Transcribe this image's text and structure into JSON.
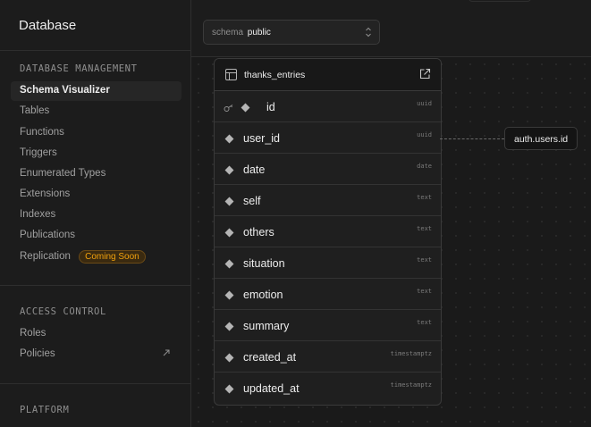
{
  "sidebar": {
    "title": "Database",
    "sections": {
      "management": {
        "title": "DATABASE MANAGEMENT",
        "items": [
          {
            "label": "Schema Visualizer"
          },
          {
            "label": "Tables"
          },
          {
            "label": "Functions"
          },
          {
            "label": "Triggers"
          },
          {
            "label": "Enumerated Types"
          },
          {
            "label": "Extensions"
          },
          {
            "label": "Indexes"
          },
          {
            "label": "Publications"
          },
          {
            "label": "Replication",
            "badge": "Coming Soon"
          }
        ]
      },
      "access": {
        "title": "ACCESS CONTROL",
        "items": [
          {
            "label": "Roles"
          },
          {
            "label": "Policies",
            "icon": "external-link-icon"
          }
        ]
      },
      "platform": {
        "title": "PLATFORM"
      }
    }
  },
  "schema_select": {
    "label": "schema",
    "value": "public"
  },
  "table": {
    "name": "thanks_entries",
    "columns": [
      {
        "name": "id",
        "type": "uuid",
        "primary_key": true
      },
      {
        "name": "user_id",
        "type": "uuid"
      },
      {
        "name": "date",
        "type": "date"
      },
      {
        "name": "self",
        "type": "text"
      },
      {
        "name": "others",
        "type": "text"
      },
      {
        "name": "situation",
        "type": "text"
      },
      {
        "name": "emotion",
        "type": "text"
      },
      {
        "name": "summary",
        "type": "text"
      },
      {
        "name": "created_at",
        "type": "timestamptz"
      },
      {
        "name": "updated_at",
        "type": "timestamptz"
      }
    ]
  },
  "relation": {
    "target": "auth.users.id"
  },
  "colors": {
    "background": "#1c1c1c",
    "canvas": "#1a1a1a",
    "accent_badge": "#f1a10d",
    "border": "#2e2e2e"
  }
}
